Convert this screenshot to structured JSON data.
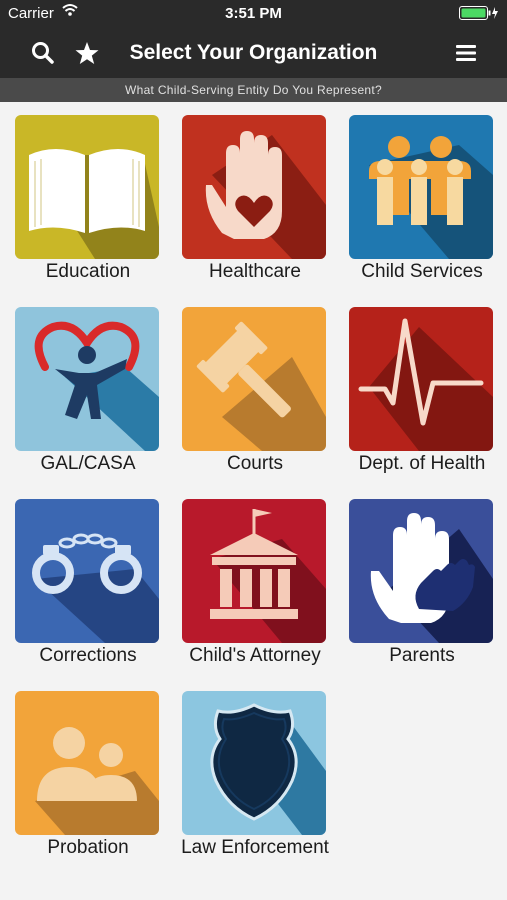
{
  "status_bar": {
    "carrier": "Carrier",
    "time": "3:51 PM"
  },
  "nav_bar": {
    "title": "Select Your Organization"
  },
  "subheader": {
    "text": "What Child-Serving Entity Do You Represent?"
  },
  "organizations": [
    {
      "label": "Education",
      "color": "#c9b727"
    },
    {
      "label": "Healthcare",
      "color": "#c0311f"
    },
    {
      "label": "Child Services",
      "color": "#1f78b0"
    },
    {
      "label": "GAL/CASA",
      "color": "#8fc4dc"
    },
    {
      "label": "Courts",
      "color": "#f2a43a"
    },
    {
      "label": "Dept. of Health",
      "color": "#b5221a"
    },
    {
      "label": "Corrections",
      "color": "#3b67b2"
    },
    {
      "label": "Child's Attorney",
      "color": "#b8192b"
    },
    {
      "label": "Parents",
      "color": "#3a4f9a"
    },
    {
      "label": "Probation",
      "color": "#f2a43a"
    },
    {
      "label": "Law Enforcement",
      "color": "#8cc6e0"
    }
  ]
}
